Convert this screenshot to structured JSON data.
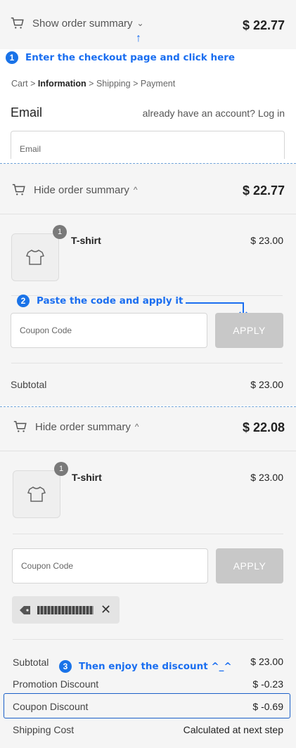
{
  "top": {
    "toggle_label": "Show order summary",
    "chevron": "⌄",
    "total": "$ 22.77",
    "arrow": "↑"
  },
  "annotations": {
    "step1": {
      "number": "1",
      "text": "Enter the checkout page and click here"
    },
    "step2": {
      "number": "2",
      "text": "Paste the code and apply it"
    },
    "step3": {
      "number": "3",
      "text": "Then enjoy the discount ^_^"
    }
  },
  "checkout": {
    "breadcrumb": {
      "cart": "Cart",
      "information": "Information",
      "shipping": "Shipping",
      "payment": "Payment",
      "sep": ">"
    },
    "email_heading": "Email",
    "account_prompt": "already have an account?",
    "login_link": "Log in",
    "email_placeholder": "Email"
  },
  "summary1": {
    "toggle_label": "Hide order summary",
    "chevron": "^",
    "total": "$ 22.77",
    "item": {
      "qty": "1",
      "name": "T-shirt",
      "price": "$ 23.00"
    },
    "coupon_placeholder": "Coupon Code",
    "apply_label": "APPLY",
    "subtotal_label": "Subtotal",
    "subtotal_value": "$ 23.00"
  },
  "summary2": {
    "toggle_label": "Hide order summary",
    "chevron": "^",
    "total": "$ 22.08",
    "item": {
      "qty": "1",
      "name": "T-shirt",
      "price": "$ 23.00"
    },
    "coupon_placeholder": "Coupon Code",
    "apply_label": "APPLY",
    "remove_symbol": "✕",
    "subtotal_label": "Subtotal",
    "subtotal_value": "$ 23.00",
    "promo_label": "Promotion Discount",
    "promo_value": "$ -0.23",
    "coupon_discount_label": "Coupon Discount",
    "coupon_discount_value": "$ -0.69",
    "shipping_label": "Shipping Cost",
    "shipping_value": "Calculated at next step"
  },
  "colors": {
    "accent": "#1a73e8",
    "annotation": "#1a6ef0",
    "highlight": "#1a5fc8",
    "apply_disabled": "#c8c8c8"
  },
  "icons": [
    "cart-icon",
    "tshirt-icon",
    "tag-icon",
    "close-icon",
    "arrow-up-icon",
    "arrow-bent-icon"
  ]
}
